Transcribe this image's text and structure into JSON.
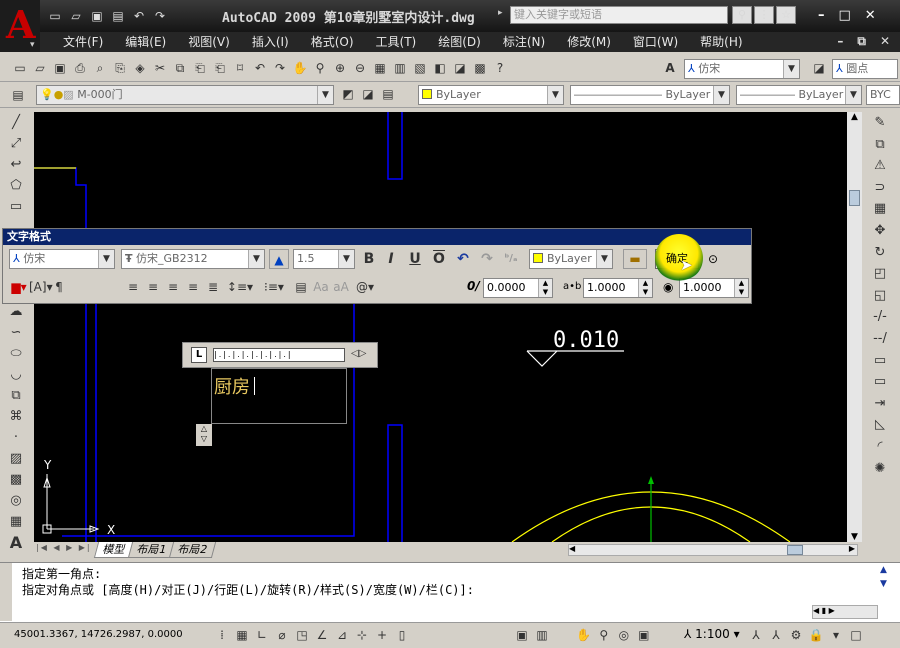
{
  "app": {
    "title": "AutoCAD 2009 第10章别墅室内设计.dwg",
    "search_placeholder": "键入关键字或短语"
  },
  "menu": [
    "文件(F)",
    "编辑(E)",
    "视图(V)",
    "插入(I)",
    "格式(O)",
    "工具(T)",
    "绘图(D)",
    "标注(N)",
    "修改(M)",
    "窗口(W)",
    "帮助(H)"
  ],
  "styles": {
    "text_style": "仿宋",
    "dim_style": "圆点"
  },
  "layers": {
    "current": "M-000门",
    "color": "ByLayer",
    "linetype": "ByLayer",
    "lineweight": "ByLayer",
    "plotstyle": "BYC"
  },
  "text_format": {
    "title": "文字格式",
    "style": "仿宋",
    "font": "仿宋_GB2312",
    "height": "1.5",
    "color": "ByLayer",
    "ok": "确定",
    "oblique": "0.0000",
    "tracking": "1.0000",
    "width": "1.0000"
  },
  "drawing": {
    "text_input": "厨房",
    "elevation": "0.010",
    "ucs_x": "X",
    "ucs_y": "Y"
  },
  "tabs": [
    "模型",
    "布局1",
    "布局2"
  ],
  "command": {
    "line1": "指定第一角点:",
    "line2": "指定对角点或 [高度(H)/对正(J)/行距(L)/旋转(R)/样式(S)/宽度(W)/栏(C)]:"
  },
  "status": {
    "coords": "45001.3367, 14726.2987, 0.0000",
    "scale": "1:100"
  },
  "colors": {
    "accent": "#c80000",
    "canvas": "#000000",
    "wall": "#0000ff",
    "arc": "#ffff00",
    "ucs": "#ffffff"
  }
}
